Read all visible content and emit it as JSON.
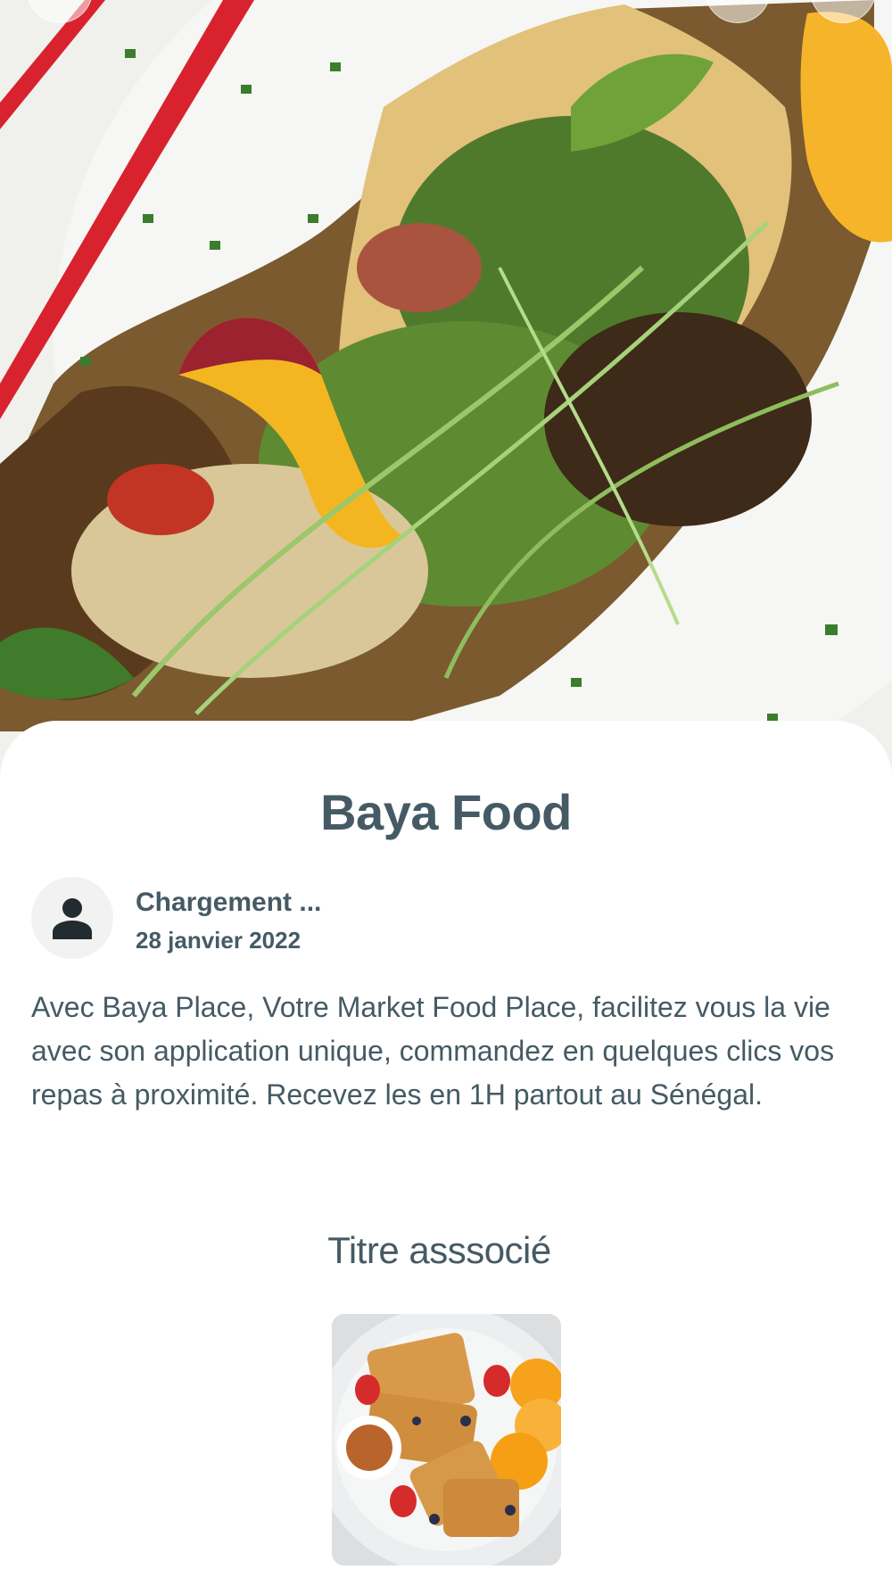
{
  "article": {
    "title": "Baya Food",
    "author_name": "Chargement ...",
    "date": "28 janvier 2022",
    "description": "Avec Baya Place, Votre Market Food Place, facilitez vous la vie avec son application unique, commandez en quelques clics vos repas à proximité. Recevez les en 1H partout au Sénégal."
  },
  "related": {
    "title": "Titre asssocié"
  },
  "icons": {
    "back": "back-icon",
    "share": "share-icon",
    "favorite": "favorite-icon",
    "avatar": "person-icon"
  },
  "colors": {
    "text": "#455a64",
    "avatar_bg": "#f2f2f2",
    "background": "#ffffff"
  }
}
